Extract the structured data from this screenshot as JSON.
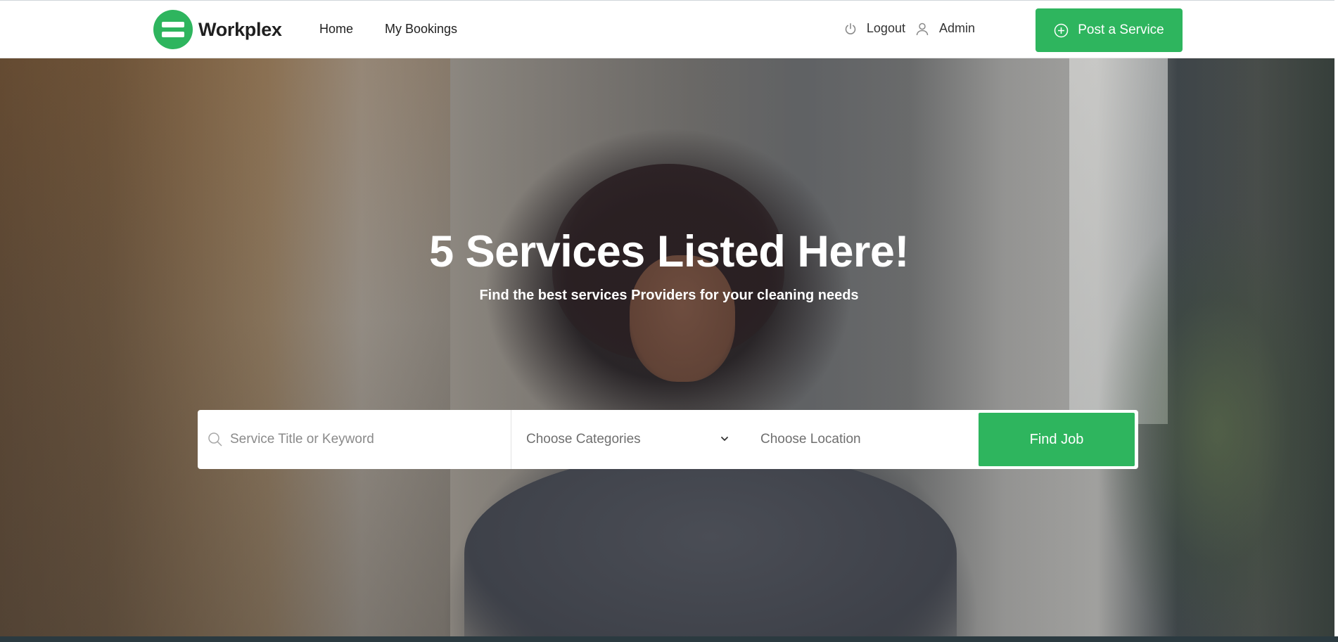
{
  "brand": {
    "name": "Workplex",
    "accent_color": "#2eb55e"
  },
  "nav": {
    "links": [
      {
        "label": "Home"
      },
      {
        "label": "My Bookings"
      }
    ],
    "logout_label": "Logout",
    "user_label": "Admin",
    "post_button_label": "Post a Service"
  },
  "hero": {
    "title": "5 Services Listed Here!",
    "subtitle": "Find the best services Providers for your cleaning needs"
  },
  "search": {
    "keyword_placeholder": "Service Title or Keyword",
    "keyword_value": "",
    "category_selected": "Choose Categories",
    "location_selected": "Choose Location",
    "submit_label": "Find Job"
  },
  "icons": {
    "logo": "logo-mark-icon",
    "logout": "power-icon",
    "user": "user-icon",
    "post": "plus-circle-icon",
    "search": "search-icon",
    "dropdown": "chevron-down-icon"
  }
}
